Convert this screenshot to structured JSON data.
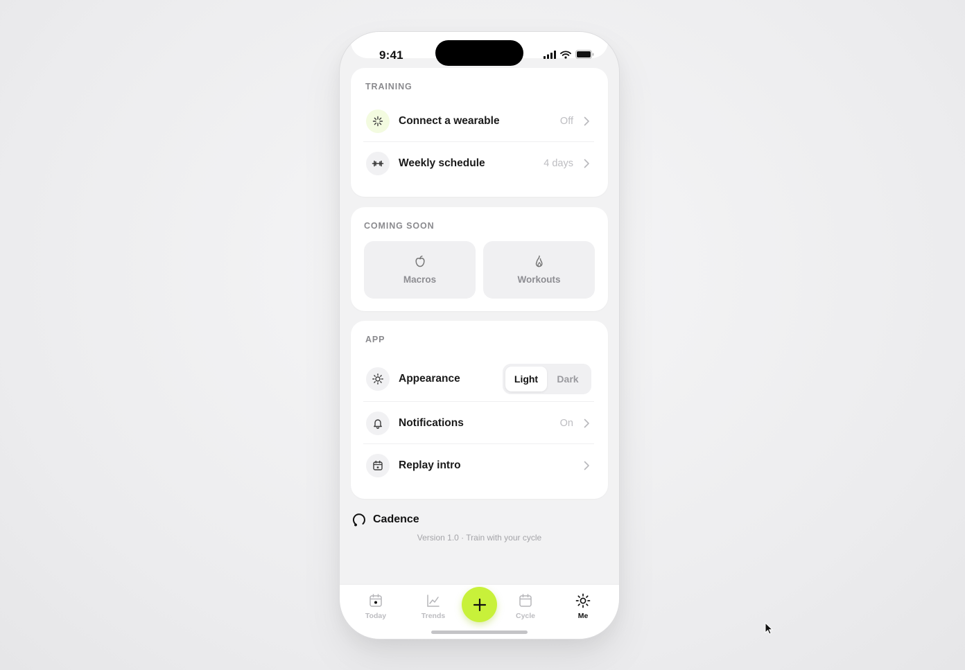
{
  "status_bar": {
    "time": "9:41"
  },
  "training": {
    "title": "TRAINING",
    "rows": [
      {
        "icon": "sparkle-icon",
        "label": "Connect a wearable",
        "value": "Off"
      },
      {
        "icon": "dumbbell-icon",
        "label": "Weekly schedule",
        "value": "4 days"
      }
    ]
  },
  "coming_soon": {
    "title": "COMING SOON",
    "tiles": [
      {
        "icon": "apple-icon",
        "label": "Macros"
      },
      {
        "icon": "flame-icon",
        "label": "Workouts"
      }
    ]
  },
  "app": {
    "title": "APP",
    "appearance": {
      "label": "Appearance",
      "options": [
        "Light",
        "Dark"
      ],
      "selected": "Light"
    },
    "notifications": {
      "label": "Notifications",
      "value": "On"
    },
    "replay": {
      "label": "Replay intro"
    }
  },
  "footer": {
    "brand": "Cadence",
    "version": "Version 1.0 · Train with your cycle"
  },
  "tabbar": {
    "tabs": [
      {
        "label": "Today",
        "icon": "calendar-day-icon",
        "active": false
      },
      {
        "label": "Trends",
        "icon": "chart-line-icon",
        "active": false
      },
      {
        "label": "Cycle",
        "icon": "calendar-icon",
        "active": false
      },
      {
        "label": "Me",
        "icon": "sun-icon",
        "active": true
      }
    ],
    "fab": "plus-icon"
  },
  "colors": {
    "accent": "#c8f13a",
    "background": "#f2f2f3",
    "card": "#ffffff",
    "muted": "#8a8a8e"
  }
}
